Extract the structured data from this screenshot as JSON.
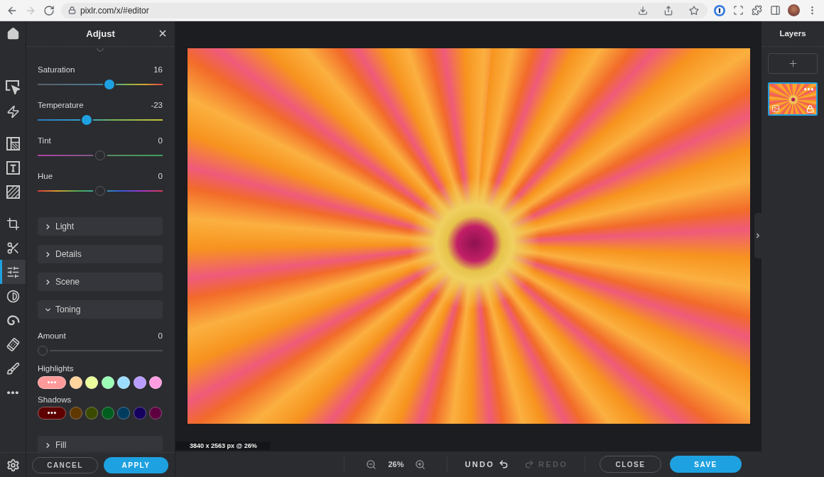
{
  "browser": {
    "url": "pixlr.com/x/#editor",
    "nav": [
      {
        "kind": "back",
        "disabled": false
      },
      {
        "kind": "forward",
        "disabled": true
      },
      {
        "kind": "reload",
        "disabled": false
      }
    ]
  },
  "tool_groups": [
    {
      "tools": [
        {
          "kind": "select",
          "selected": false
        },
        {
          "kind": "quick",
          "selected": false
        }
      ]
    },
    {
      "tools": [
        {
          "kind": "layout",
          "selected": false
        },
        {
          "kind": "text",
          "selected": false
        },
        {
          "kind": "pattern",
          "selected": false
        }
      ]
    },
    {
      "tools": [
        {
          "kind": "crop",
          "selected": false
        },
        {
          "kind": "cutout",
          "selected": false
        },
        {
          "kind": "adjust",
          "selected": true
        },
        {
          "kind": "filter",
          "selected": false
        },
        {
          "kind": "liquify",
          "selected": false
        },
        {
          "kind": "heal",
          "selected": false
        },
        {
          "kind": "draw",
          "selected": false
        },
        {
          "kind": "more",
          "selected": false
        }
      ]
    }
  ],
  "adjust_panel": {
    "title": "Adjust",
    "sliders": [
      {
        "label": "Saturation",
        "reading": "16",
        "kind": "saturation",
        "level": 0.58,
        "modified": true
      },
      {
        "label": "Temperature",
        "reading": "-23",
        "kind": "temperature",
        "level": 0.38,
        "modified": true
      },
      {
        "label": "Tint",
        "reading": "0",
        "kind": "tint",
        "level": 0.5,
        "modified": false
      },
      {
        "label": "Hue",
        "reading": "0",
        "kind": "hue",
        "level": 0.5,
        "modified": false
      }
    ],
    "sections": [
      {
        "label": "Light",
        "expanded": false
      },
      {
        "label": "Details",
        "expanded": false
      },
      {
        "label": "Scene",
        "expanded": false
      },
      {
        "label": "Toning",
        "expanded": true,
        "amount": {
          "label": "Amount",
          "reading": "0",
          "kind": "plain",
          "level": 0,
          "modified": false
        },
        "palettes": [
          {
            "label": "Highlights",
            "picker": {
              "color": "#ff9a9a"
            },
            "swatches": [
              {
                "color": "#ffd39c"
              },
              {
                "color": "#eaff9c"
              },
              {
                "color": "#9cffb6"
              },
              {
                "color": "#9cdcff"
              },
              {
                "color": "#b99cff"
              },
              {
                "color": "#ff9ce0"
              }
            ]
          },
          {
            "label": "Shadows",
            "picker": {
              "color": "#5e0000"
            },
            "swatches": [
              {
                "color": "#5e3800"
              },
              {
                "color": "#3a4a00"
              },
              {
                "color": "#005e1e"
              },
              {
                "color": "#003c5e"
              },
              {
                "color": "#16005e"
              },
              {
                "color": "#5e0040"
              }
            ]
          }
        ]
      },
      {
        "label": "Fill",
        "expanded": false
      }
    ],
    "cancel": "CANCEL",
    "apply": "APPLY"
  },
  "canvas": {
    "image_info": "3840 x 2563 px @ 26%"
  },
  "bottom_bar": {
    "zoom": "26%",
    "undo": {
      "label": "UNDO",
      "disabled": false
    },
    "redo": {
      "label": "REDO",
      "disabled": true
    },
    "close": "CLOSE",
    "save": "SAVE"
  },
  "layers_panel": {
    "title": "Layers",
    "layers": [
      {
        "selected": true,
        "locked": true
      }
    ]
  }
}
